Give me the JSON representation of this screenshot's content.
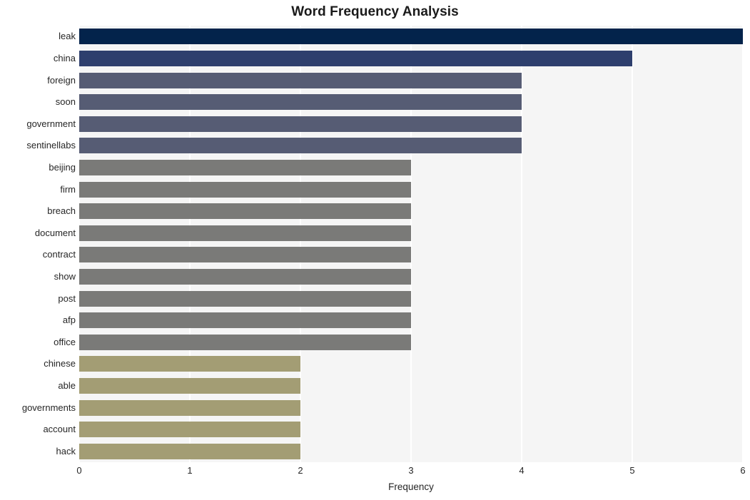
{
  "chart_data": {
    "type": "bar",
    "orientation": "horizontal",
    "title": "Word Frequency Analysis",
    "xlabel": "Frequency",
    "ylabel": "",
    "xlim": [
      0,
      6
    ],
    "ylim": [
      0,
      20
    ],
    "grid": true,
    "legend": false,
    "xticks": [
      "0",
      "1",
      "2",
      "3",
      "4",
      "5",
      "6"
    ],
    "xtick_values": [
      0,
      1,
      2,
      3,
      4,
      5,
      6
    ],
    "categories": [
      "leak",
      "china",
      "foreign",
      "soon",
      "government",
      "sentinellabs",
      "beijing",
      "firm",
      "breach",
      "document",
      "contract",
      "show",
      "post",
      "afp",
      "office",
      "chinese",
      "able",
      "governments",
      "account",
      "hack"
    ],
    "values": [
      6,
      5,
      4,
      4,
      4,
      4,
      3,
      3,
      3,
      3,
      3,
      3,
      3,
      3,
      3,
      2,
      2,
      2,
      2,
      2
    ],
    "bar_colors": [
      "#03234b",
      "#2e3f6d",
      "#565c74",
      "#565c74",
      "#565c74",
      "#565c74",
      "#7a7a78",
      "#7a7a78",
      "#7a7a78",
      "#7a7a78",
      "#7a7a78",
      "#7a7a78",
      "#7a7a78",
      "#7a7a78",
      "#7a7a78",
      "#a39d74",
      "#a39d74",
      "#a39d74",
      "#a39d74",
      "#a39d74"
    ],
    "plot_background": "#f5f5f5",
    "gridline_color": "#ffffff",
    "figure_background": "#ffffff"
  }
}
